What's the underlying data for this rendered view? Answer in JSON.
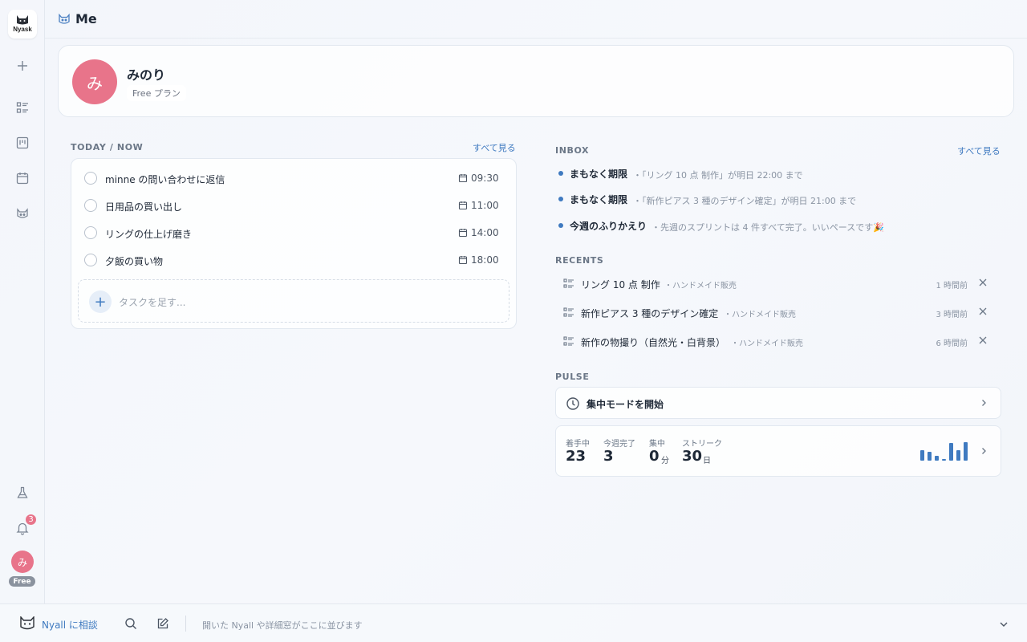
{
  "app": {
    "logo_text": "Nyask"
  },
  "header": {
    "title": "Me"
  },
  "sidebar": {
    "icons": [
      "plus-icon",
      "list-icon",
      "board-icon",
      "calendar-icon",
      "cat-icon",
      "flask-icon",
      "bell-icon"
    ],
    "notifications_count": "3",
    "avatar_initial": "み",
    "plan_badge": "Free"
  },
  "profile": {
    "initial": "み",
    "name": "みのり",
    "plan": "Free プラン"
  },
  "today": {
    "title": "TODAY / NOW",
    "see_all": "すべて見る",
    "tasks": [
      {
        "title": "minne の問い合わせに返信",
        "time": "09:30"
      },
      {
        "title": "日用品の買い出し",
        "time": "11:00"
      },
      {
        "title": "リングの仕上げ磨き",
        "time": "14:00"
      },
      {
        "title": "夕飯の買い物",
        "time": "18:00"
      }
    ],
    "add_placeholder": "タスクを足す..."
  },
  "inbox": {
    "title": "INBOX",
    "see_all": "すべて見る",
    "items": [
      {
        "title": "まもなく期限",
        "detail": "・「リング 10 点 制作」が明日 22:00 まで"
      },
      {
        "title": "まもなく期限",
        "detail": "・「新作ピアス 3 種のデザイン確定」が明日 21:00 まで"
      },
      {
        "title": "今週のふりかえり",
        "detail": "・先週のスプリントは 4 件すべて完了。いいペースです🎉"
      }
    ]
  },
  "recents": {
    "title": "RECENTS",
    "items": [
      {
        "title": "リング 10 点 制作",
        "project": "・ハンドメイド販売",
        "time": "1 時間前"
      },
      {
        "title": "新作ピアス 3 種のデザイン確定",
        "project": "・ハンドメイド販売",
        "time": "3 時間前"
      },
      {
        "title": "新作の物撮り（自然光・白背景）",
        "project": "・ハンドメイド販売",
        "time": "6 時間前"
      }
    ]
  },
  "pulse": {
    "title": "PULSE",
    "focus_label": "集中モードを開始",
    "stats": [
      {
        "label": "着手中",
        "value": "23",
        "unit": ""
      },
      {
        "label": "今週完了",
        "value": "3",
        "unit": ""
      },
      {
        "label": "集中",
        "value": "0",
        "unit": "分"
      },
      {
        "label": "ストリーク",
        "value": "30",
        "unit": "日"
      }
    ],
    "sparkline": [
      0.55,
      0.45,
      0.25,
      0.1,
      0.9,
      0.55,
      0.95
    ]
  },
  "bottom": {
    "ask_label": "Nyall に相談",
    "hint": "開いた Nyall や詳細窓がここに並びます"
  }
}
